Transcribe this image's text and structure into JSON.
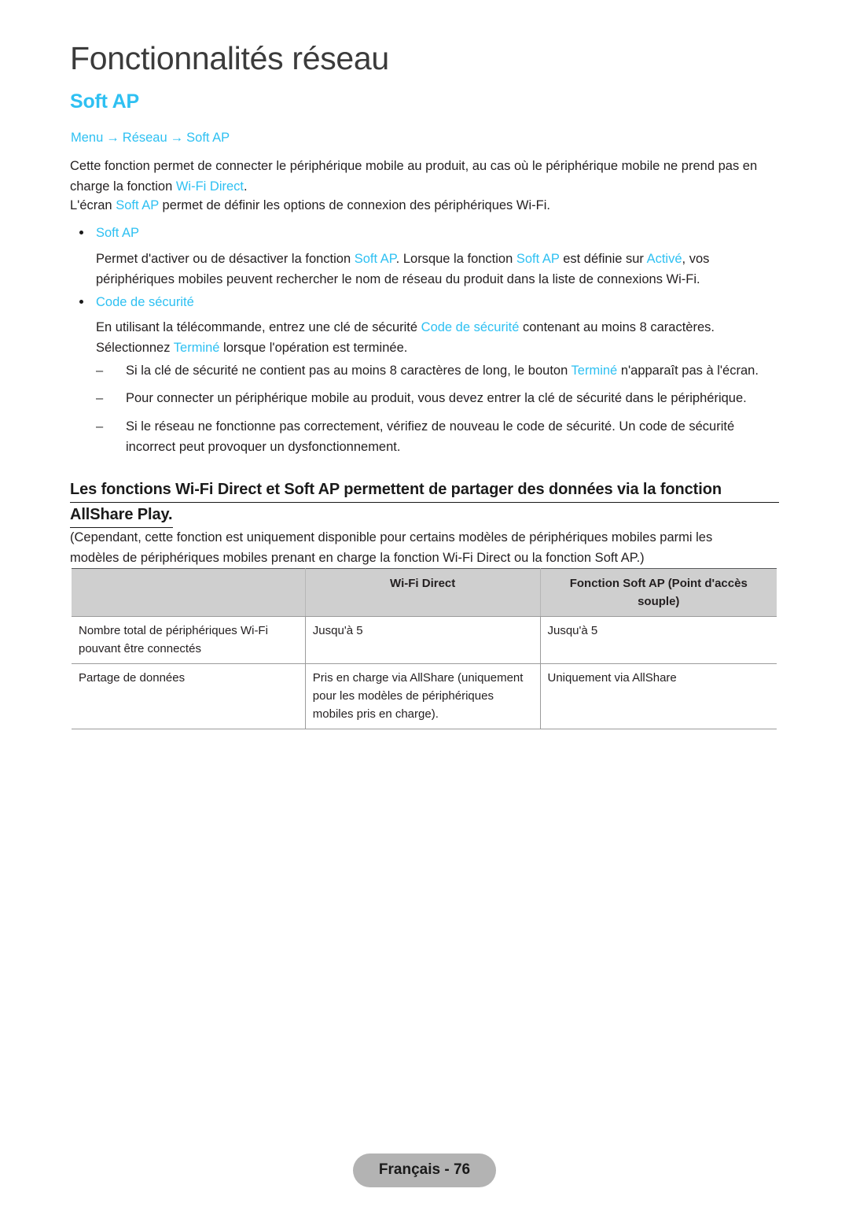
{
  "page": {
    "chapter_title": "Fonctionnalités réseau",
    "section_title": "Soft AP"
  },
  "breadcrumb": {
    "items": [
      "Menu",
      "Réseau",
      "Soft AP"
    ],
    "separator": "→"
  },
  "intro": {
    "p1_a": "Cette fonction permet de connecter le périphérique mobile au produit, au cas où le périphérique mobile ne prend pas en charge la fonction ",
    "p1_link": "Wi-Fi Direct",
    "p1_b": ".",
    "p2_a": "L'écran ",
    "p2_link": "Soft AP",
    "p2_b": " permet de définir les options de connexion des périphériques Wi-Fi."
  },
  "bullets": [
    {
      "label": "Soft AP",
      "body_a": "Permet d'activer ou de désactiver la fonction ",
      "body_link1": "Soft AP",
      "body_b": ". Lorsque la fonction ",
      "body_link2": "Soft AP",
      "body_c": " est définie sur ",
      "body_link3": "Activé",
      "body_d": ", vos périphériques mobiles peuvent rechercher le nom de réseau du produit dans la liste de connexions Wi-Fi."
    },
    {
      "label": "Code de sécurité",
      "body_a": "En utilisant la télécommande, entrez une clé de sécurité ",
      "body_link1": "Code de sécurité",
      "body_b": " contenant au moins 8 caractères. Sélectionnez ",
      "body_link2": "Terminé",
      "body_c": " lorsque l'opération est terminée."
    }
  ],
  "dashes": [
    {
      "text_a": "Si la clé de sécurité ne contient pas au moins 8 caractères de long, le bouton ",
      "link": "Terminé",
      "text_b": " n'apparaît pas à l'écran."
    },
    {
      "text_a": "Pour connecter un périphérique mobile au produit, vous devez entrer la clé de sécurité dans le périphérique.",
      "link": "",
      "text_b": ""
    },
    {
      "text_a": "Si le réseau ne fonctionne pas correctement, vérifiez de nouveau le code de sécurité. Un code de sécurité incorrect peut provoquer un dysfonctionnement.",
      "link": "",
      "text_b": ""
    }
  ],
  "note": {
    "heading_line1": "Les fonctions Wi-Fi Direct et Soft AP permettent de partager des données via la fonction",
    "heading_line2": "AllShare Play.",
    "body": "(Cependant, cette fonction est uniquement disponible pour certains modèles de périphériques mobiles parmi les modèles de périphériques mobiles prenant en charge la fonction Wi-Fi Direct ou la fonction Soft AP.)"
  },
  "table": {
    "headers": [
      "",
      "Wi-Fi Direct",
      "Fonction Soft AP (Point d'accès souple)"
    ],
    "rows": [
      {
        "label": "Nombre total de périphériques Wi-Fi pouvant être connectés",
        "wifi_direct": "Jusqu'à 5",
        "soft_ap": "Jusqu'à 5"
      },
      {
        "label": "Partage de données",
        "wifi_direct": "Pris en charge via AllShare (uniquement pour les modèles de périphériques mobiles pris en charge).",
        "soft_ap": "Uniquement via AllShare"
      }
    ]
  },
  "footer": {
    "label": "Français - 76"
  },
  "colors": {
    "accent": "#2ec0f2",
    "text": "#231f20",
    "table_header_bg": "#cfcfcf",
    "footer_bg": "#b3b3b3"
  }
}
